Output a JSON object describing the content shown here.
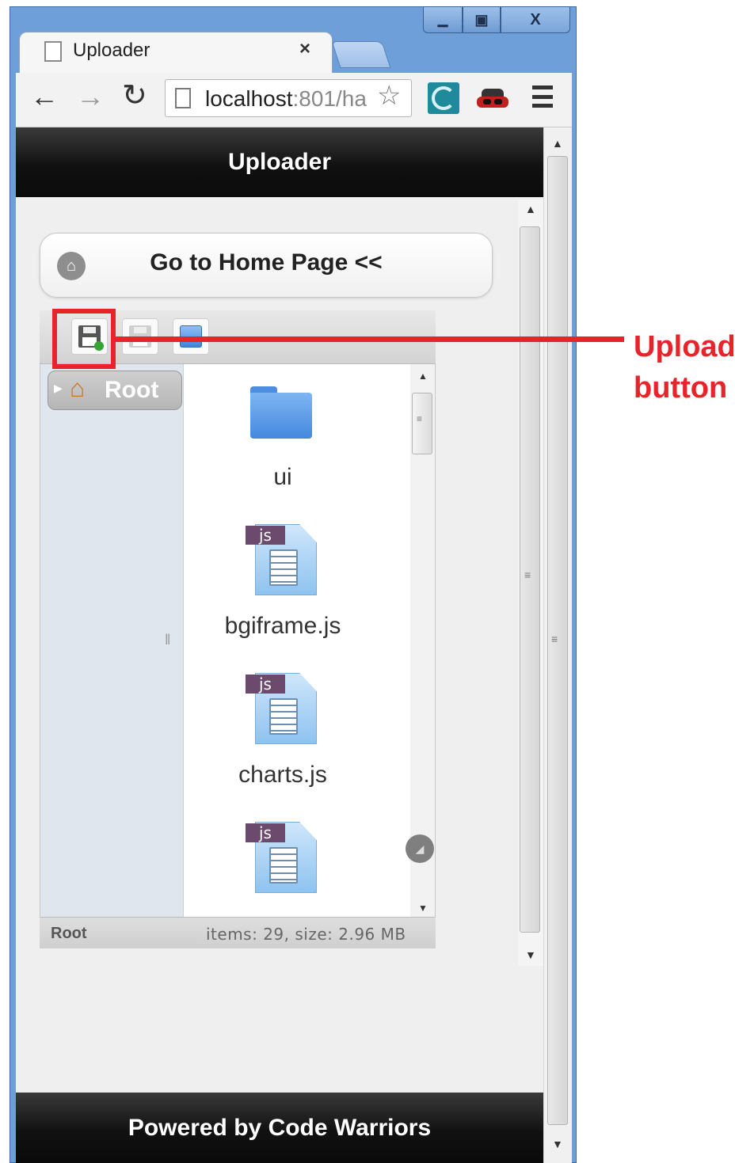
{
  "browser": {
    "window_controls": {
      "minimize": "▭",
      "maximize": "⧠",
      "close": "X"
    },
    "tab": {
      "title": "Uploader",
      "close": "×"
    },
    "nav": {
      "back": "←",
      "forward": "→",
      "reload": "C"
    },
    "address": {
      "host": "localhost",
      "rest": ":801/ha"
    },
    "icons": [
      "file-icon",
      "star-icon",
      "extension-icon",
      "incognito-icon",
      "menu-icon"
    ]
  },
  "page": {
    "header_title": "Uploader",
    "home_button": "Go to Home Page <<",
    "footer": "Powered by Code Warriors"
  },
  "file_manager": {
    "toolbar": [
      "upload-button",
      "download-button",
      "info-button"
    ],
    "tree": {
      "root_label": "Root"
    },
    "files": [
      {
        "name": "ui",
        "type": "folder"
      },
      {
        "name": "bgiframe.js",
        "type": "js",
        "badge": "js"
      },
      {
        "name": "charts.js",
        "type": "js",
        "badge": "js"
      },
      {
        "name": "",
        "type": "js",
        "badge": "js"
      }
    ],
    "status": {
      "path": "Root",
      "summary": "items: 29, size: 2.96 MB"
    }
  },
  "annotation": {
    "line1": "Upload",
    "line2": "button",
    "color": "#e8232a"
  }
}
